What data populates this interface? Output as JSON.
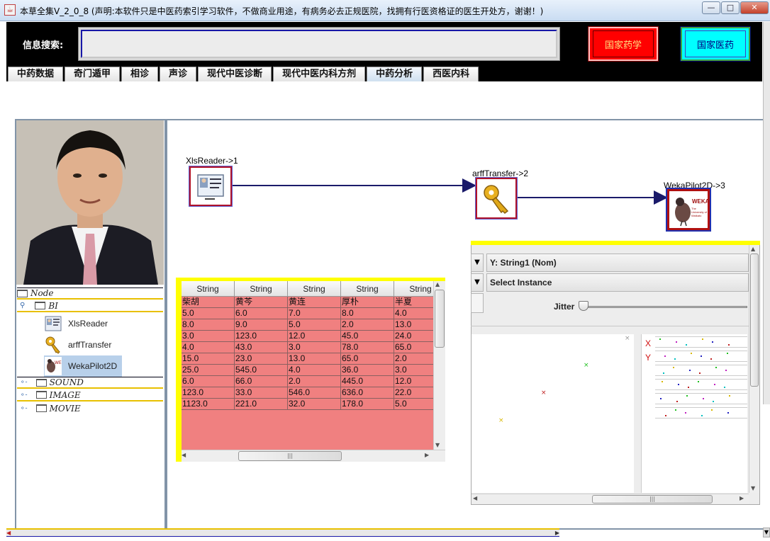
{
  "window": {
    "title": "本草全集V_2_0_8 (声明:本软件只是中医药索引学习软件，不做商业用途，有病务必去正规医院，找拥有行医资格证的医生开处方，谢谢！)",
    "min_glyph": "—",
    "max_glyph": "□",
    "close_glyph": "✕"
  },
  "search": {
    "label": "信息搜索:",
    "value": ""
  },
  "buttons": {
    "national_pharmacy": "国家药学",
    "national_medicine": "国家医药"
  },
  "tabs": [
    {
      "label": "中药数据",
      "active": false
    },
    {
      "label": "奇门遁甲",
      "active": false
    },
    {
      "label": "相诊",
      "active": false
    },
    {
      "label": "声诊",
      "active": false
    },
    {
      "label": "现代中医诊断",
      "active": false
    },
    {
      "label": "现代中医内科方剂",
      "active": false
    },
    {
      "label": "中药分析",
      "active": true
    },
    {
      "label": "西医内科",
      "active": false
    }
  ],
  "tree": {
    "root": "Node",
    "bi": "BI",
    "leaves": [
      "XlsReader",
      "arffTransfer",
      "WekaPilot2D"
    ],
    "selected": "WekaPilot2D",
    "sound": "SOUND",
    "image": "IMAGE",
    "movie": "MOVIE"
  },
  "flow": {
    "nodes": [
      "XlsReader->1",
      "arffTransfer->2",
      "WekaPilot2D->3"
    ],
    "weka_logo": "WEKA",
    "weka_sub": "The University of Waikato"
  },
  "table": {
    "headers": [
      "String",
      "String",
      "String",
      "String",
      "String"
    ],
    "rows": [
      [
        "柴胡",
        "黄芩",
        "黄连",
        "厚朴",
        "半夏"
      ],
      [
        "5.0",
        "6.0",
        "7.0",
        "8.0",
        "4.0"
      ],
      [
        "8.0",
        "9.0",
        "5.0",
        "2.0",
        "13.0"
      ],
      [
        "3.0",
        "123.0",
        "12.0",
        "45.0",
        "24.0"
      ],
      [
        "4.0",
        "43.0",
        "3.0",
        "78.0",
        "65.0"
      ],
      [
        "15.0",
        "23.0",
        "13.0",
        "65.0",
        "2.0"
      ],
      [
        "25.0",
        "545.0",
        "4.0",
        "36.0",
        "3.0"
      ],
      [
        "6.0",
        "66.0",
        "2.0",
        "445.0",
        "12.0"
      ],
      [
        "123.0",
        "33.0",
        "546.0",
        "636.0",
        "22.0"
      ],
      [
        "1123.0",
        "221.0",
        "32.0",
        "178.0",
        "5.0"
      ]
    ]
  },
  "weka": {
    "y_axis": "Y: String1 (Nom)",
    "select_instance": "Select Instance",
    "jitter_label": "Jitter",
    "x_marker": "X",
    "y_marker": "Y",
    "scroll_grip": "|||"
  }
}
